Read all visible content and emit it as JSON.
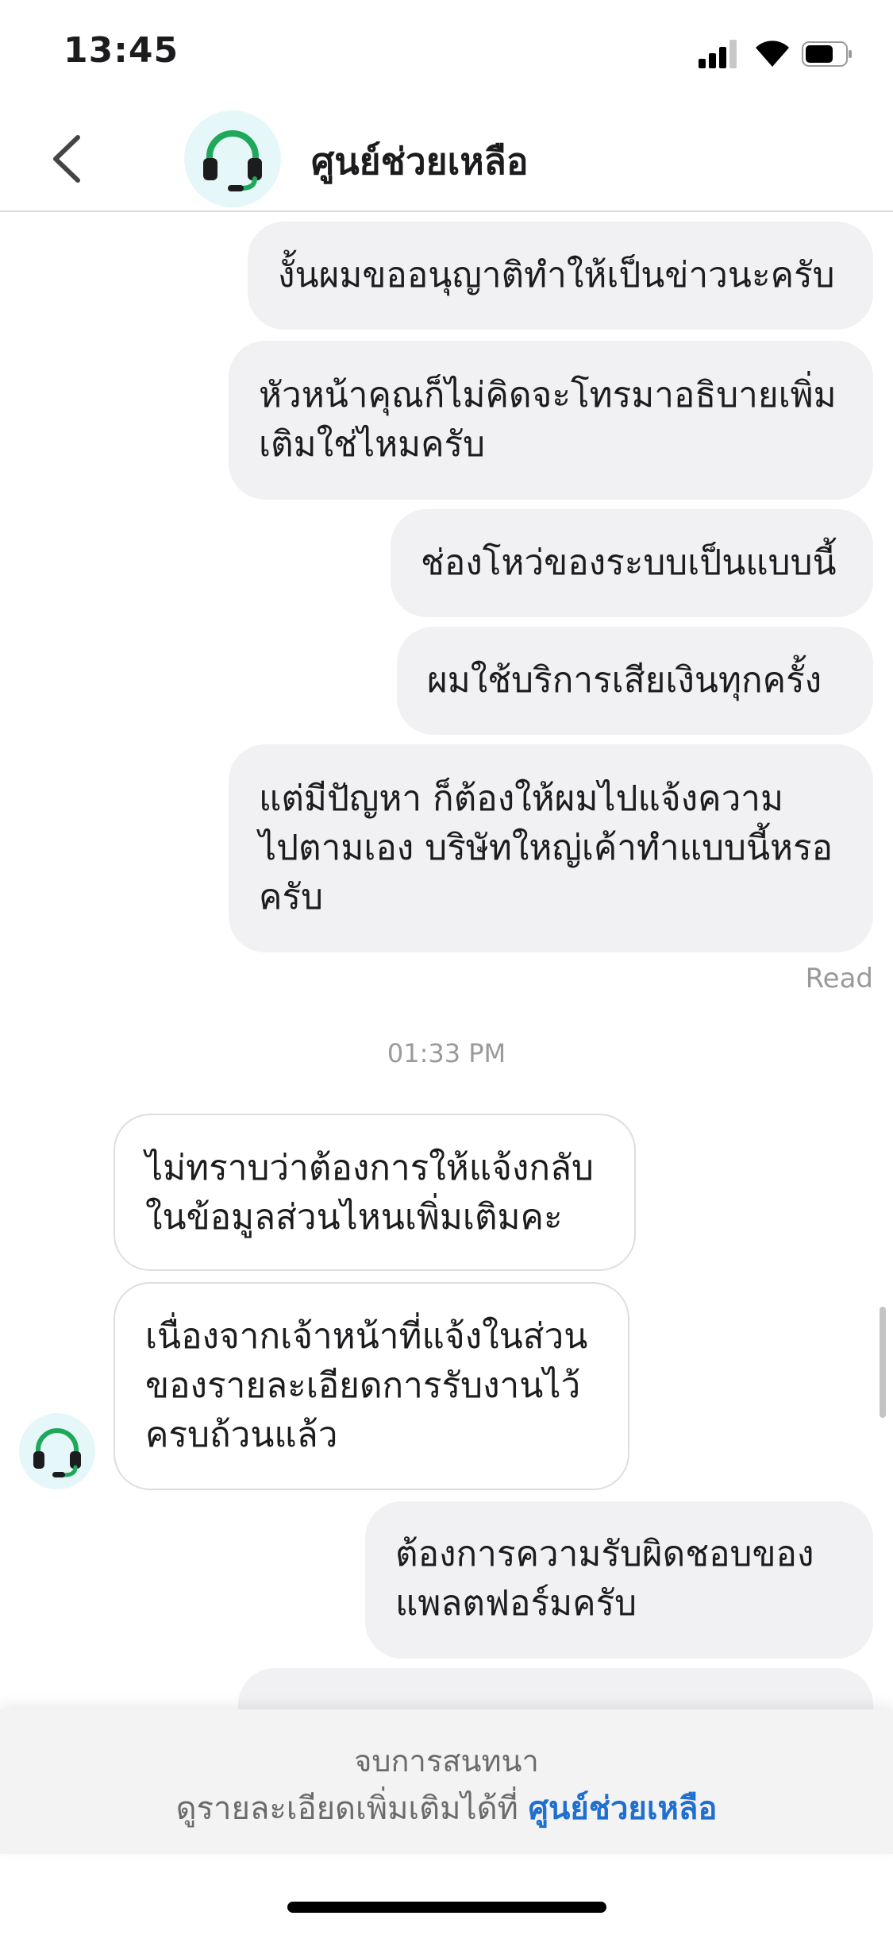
{
  "status_bar": {
    "time": "13:45"
  },
  "header": {
    "title": "ศูนย์ช่วยเหลือ",
    "avatar_icon": "headset-icon",
    "back_icon": "chevron-left-icon"
  },
  "messages": [
    {
      "side": "sent",
      "lines": [
        "งั้นผมขออนุญาติทำให้เป็นข่าวนะครับ"
      ]
    },
    {
      "side": "sent",
      "lines": [
        "หัวหน้าคุณก็ไม่คิดจะโทรมาอธิบายเพิ่ม",
        "เติมใช่ไหมครับ"
      ]
    },
    {
      "side": "sent",
      "lines": [
        "ช่องโหว่ของระบบเป็นแบบนี้"
      ]
    },
    {
      "side": "sent",
      "lines": [
        "ผมใช้บริการเสียเงินทุกครั้ง"
      ]
    },
    {
      "side": "sent",
      "lines": [
        "แต่มีปัญหา ก็ต้องให้ผมไปแจ้งความ",
        "ไปตามเอง บริษัทใหญ่เค้าทำแบบนี้หรอ",
        "ครับ"
      ]
    },
    {
      "side": "recv",
      "lines": [
        "ไม่ทราบว่าต้องการให้แจ้งกลับ",
        "ในข้อมูลส่วนไหนเพิ่มเติมคะ"
      ]
    },
    {
      "side": "recv",
      "lines": [
        "เนื่องจากเจ้าหน้าที่แจ้งในส่วน",
        "ของรายละเอียดการรับงานไว้",
        "ครบถ้วนแล้ว"
      ]
    },
    {
      "side": "sent",
      "lines": [
        "ต้องการความรับผิดชอบของ",
        "แพลตฟอร์มครับ"
      ]
    }
  ],
  "read_label": "Read",
  "timestamp": "01:33 PM",
  "footer": {
    "end_text": "จบการสนทนา",
    "detail_prefix": "ดูรายละเอียดเพิ่มเติมได้ที่ ",
    "detail_link": "ศูนย์ช่วยเหลือ"
  },
  "colors": {
    "accent_green": "#1fa85a",
    "link_blue": "#1e6fd0",
    "bubble_sent": "#f1f1f3"
  }
}
